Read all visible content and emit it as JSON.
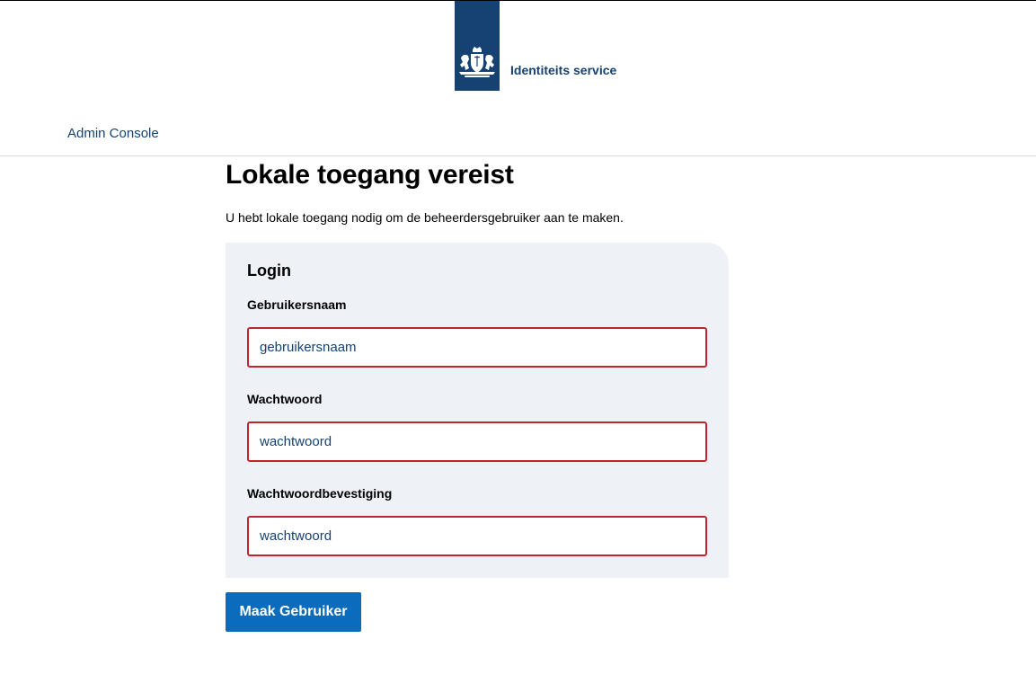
{
  "header": {
    "logo_text": "Identiteits service",
    "logo_icon": "coat-of-arms-icon",
    "brand_color": "#154273"
  },
  "nav": {
    "admin_console": "Admin Console"
  },
  "main": {
    "title": "Lokale toegang vereist",
    "intro": "U hebt lokale toegang nodig om de beheerdersgebruiker aan te maken.",
    "form": {
      "title": "Login",
      "username": {
        "label": "Gebruikersnaam",
        "placeholder": "gebruikersnaam",
        "value": ""
      },
      "password": {
        "label": "Wachtwoord",
        "placeholder": "wachtwoord",
        "value": ""
      },
      "password_confirm": {
        "label": "Wachtwoordbevestiging",
        "placeholder": "wachtwoord",
        "value": ""
      },
      "error_border_color": "#c0252e",
      "panel_color": "#eef2f6"
    },
    "submit_label": "Maak Gebruiker",
    "submit_color": "#0b6bbd"
  }
}
